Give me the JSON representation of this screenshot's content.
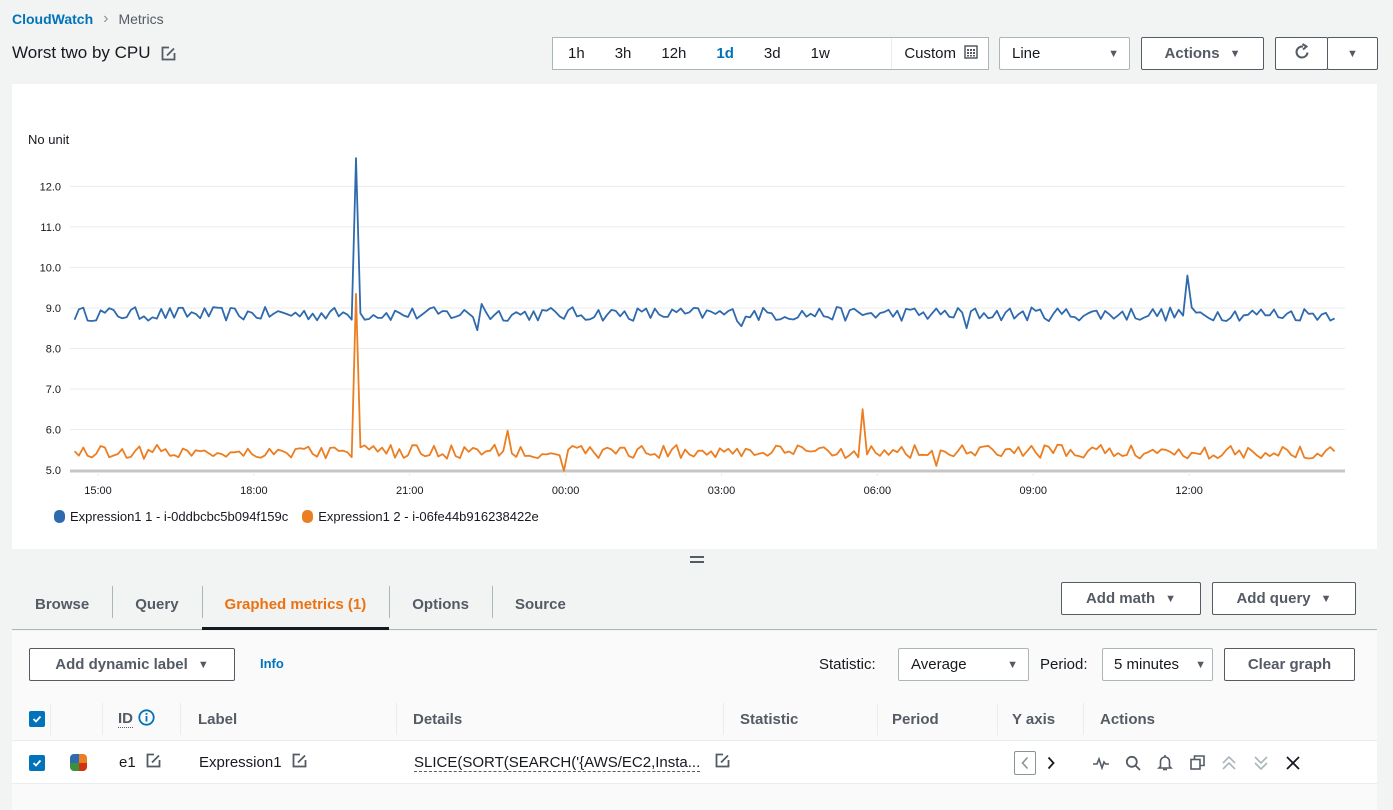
{
  "breadcrumb": {
    "root": "CloudWatch",
    "current": "Metrics"
  },
  "header": {
    "title": "Worst two by CPU"
  },
  "toolbar": {
    "time_ranges": [
      "1h",
      "3h",
      "12h",
      "1d",
      "3d",
      "1w"
    ],
    "active_time_range": "1d",
    "custom_label": "Custom",
    "chart_type": "Line",
    "actions_label": "Actions"
  },
  "chart_data": {
    "type": "line",
    "ylabel": "No unit",
    "ylim": [
      5.0,
      12.8
    ],
    "yticks": [
      "5.0",
      "6.0",
      "7.0",
      "8.0",
      "9.0",
      "10.0",
      "11.0",
      "12.0"
    ],
    "xticks": [
      "15:00",
      "18:00",
      "21:00",
      "00:00",
      "03:00",
      "06:00",
      "09:00",
      "12:00"
    ],
    "x_domain_hours": [
      14.5,
      39.0
    ],
    "grid": true,
    "legend_position": "bottom-left",
    "series": [
      {
        "name": "Expression1 1 - i-0ddbcbc5b094f159c",
        "color": "#2e6aad",
        "baseline": 8.85,
        "spikes": [
          {
            "hour": 20.0,
            "value": 12.7
          },
          {
            "hour": 36.0,
            "value": 9.8
          },
          {
            "hour": 22.4,
            "value": 9.1
          }
        ],
        "dips": [
          {
            "hour": 22.3,
            "value": 8.45
          },
          {
            "hour": 27.4,
            "value": 8.55
          },
          {
            "hour": 31.7,
            "value": 8.5
          }
        ]
      },
      {
        "name": "Expression1 2 - i-06fe44b916238422e",
        "color": "#ec7e22",
        "baseline": 5.45,
        "spikes": [
          {
            "hour": 20.0,
            "value": 9.35
          },
          {
            "hour": 29.7,
            "value": 6.5
          },
          {
            "hour": 22.9,
            "value": 5.97
          }
        ],
        "dips": [
          {
            "hour": 24.0,
            "value": 4.98
          },
          {
            "hour": 31.1,
            "value": 5.1
          }
        ]
      }
    ]
  },
  "tabs": [
    {
      "label": "Browse",
      "active": false
    },
    {
      "label": "Query",
      "active": false
    },
    {
      "label": "Graphed metrics (1)",
      "active": true
    },
    {
      "label": "Options",
      "active": false
    },
    {
      "label": "Source",
      "active": false
    }
  ],
  "tab_actions": {
    "add_math": "Add math",
    "add_query": "Add query"
  },
  "graphed": {
    "add_dynamic_label": "Add dynamic label",
    "info": "Info",
    "statistic_label": "Statistic:",
    "statistic_value": "Average",
    "period_label": "Period:",
    "period_value": "5 minutes",
    "clear_graph": "Clear graph",
    "columns": [
      "ID",
      "Label",
      "Details",
      "Statistic",
      "Period",
      "Y axis",
      "Actions"
    ],
    "rows": [
      {
        "checked": true,
        "id": "e1",
        "label": "Expression1",
        "details": "SLICE(SORT(SEARCH('{AWS/EC2,Insta...",
        "statistic": "",
        "period": "",
        "swatch_colors": [
          "#2e6aad",
          "#ec7e22",
          "#3c8f3c",
          "#d13212"
        ]
      }
    ]
  }
}
